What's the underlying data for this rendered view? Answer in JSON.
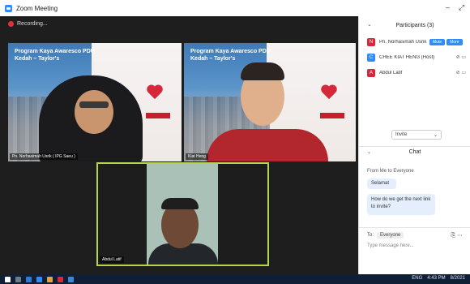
{
  "window": {
    "title": "Zoom Meeting",
    "controls": [
      "–",
      "⤢"
    ]
  },
  "recording": {
    "label": "Recording..."
  },
  "tiles": [
    {
      "poster_title": "Program Kaya Awaresco PDU Kedah – Taylor's",
      "name": "Pn. Norhasimah Usrik ( IPG Saeu )"
    },
    {
      "poster_title": "Program Kaya Awaresco PDU Kedah – Taylor's",
      "name": "Kiat Heng"
    },
    {
      "name": "Abdul Latif"
    }
  ],
  "participants_panel": {
    "header": "Participants (3)",
    "rows": [
      {
        "avatar_letter": "N",
        "avatar_color": "#d6283a",
        "name": "Pn. Norhasimah Usrik (Me)",
        "buttons": [
          "Mute",
          "More"
        ]
      },
      {
        "avatar_letter": "C",
        "avatar_color": "#2D8CFF",
        "name": "CHEE KIAT HENG (Host)",
        "icons": "⊘ ▭"
      },
      {
        "avatar_letter": "A",
        "avatar_color": "#d6283a",
        "name": "Abdul Latif",
        "icons": "⊘ ▭"
      }
    ],
    "invite_dropdown": "Invite"
  },
  "chat": {
    "header": "Chat",
    "messages": [
      {
        "from": "From Me to Everyone",
        "text": "Selamat"
      },
      {
        "from": "",
        "text": "How do we get the next link to invite?"
      }
    ],
    "send_to_label": "To:",
    "send_to_value": "Everyone",
    "input_placeholder": "Type message here..."
  },
  "taskbar": {
    "clock": "4:43 PM",
    "date": "8/2021",
    "lang": "ENG"
  },
  "colors": {
    "accent": "#2D8CFF",
    "active_speaker_border": "#b4d64a",
    "recording": "#e0303a"
  }
}
